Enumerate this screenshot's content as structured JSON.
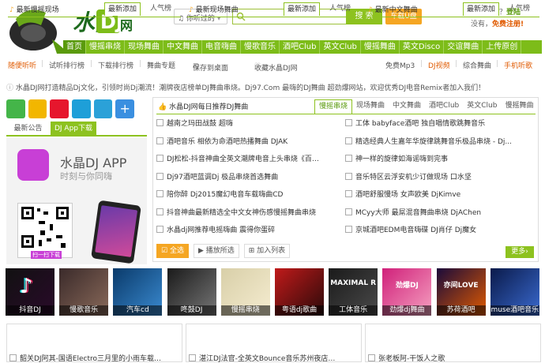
{
  "header": {
    "genre_select": "♫ 你听过的",
    "genre_arrow": "▾",
    "search_button": "搜 索",
    "udisk_button": "车载U盘",
    "login_prefix": "已有帐号？",
    "login_link": "登陆",
    "register_prefix": "没有，",
    "register_link": "免费注册!"
  },
  "main_nav": [
    "首页",
    "慢摇串烧",
    "现场舞曲",
    "中文舞曲",
    "电音嗨曲",
    "慢歌音乐",
    "酒吧Club",
    "英文Club",
    "慢摇舞曲",
    "英文Disco",
    "交谊舞曲",
    "上传原创"
  ],
  "sub_nav": {
    "left": [
      "随便听听",
      "试听排行榜",
      "下载排行榜",
      "舞曲专题"
    ],
    "save_desktop": "保存到桌面",
    "favorite": "收藏水晶DJ网",
    "right": [
      "免费Mp3",
      "DJ视频",
      "综合舞曲",
      "手机听歌"
    ]
  },
  "marquee": "水晶DJ网打造精品Dj文化，引领时尚Dj潮流！潮牌夜店榜单DJ舞曲串烧。Dj97.Com 最嗨的DJ舞曲 超劲爆网站，欢迎优秀DJ电音Remix者加入我们！",
  "left": {
    "tab_notice": "最新公告",
    "tab_app": "DJ App下载",
    "app_title": "水晶DJ APP",
    "app_slogan": "时刻与你同嗨",
    "qr_caption": "扫一扫下载"
  },
  "recommend": {
    "title": "水晶DJ网每日推荐DJ舞曲",
    "tabs": [
      "慢摇串烧",
      "现场舞曲",
      "中文舞曲",
      "酒吧Club",
      "英文Club",
      "慢摇舞曲"
    ],
    "left_items": [
      "越南之玛田战鼓 超嗨",
      "酒吧音乐 相依为命酒吧热播舞曲 DJAK",
      "DJ松松-抖音神曲全英文潮牌电音上头串烧《百…",
      "Dj97酒吧蓝调Dj 极品串烧首选舞曲",
      "陪你醉 Dj2015魔幻电音车载嗨曲CD",
      "抖音神曲最新精选全中文女神伤感慢摇舞曲串烧",
      "水晶dj网推荐电摇嗨曲 震得你蛋碎"
    ],
    "right_items": [
      "工体 babyface酒吧 独自唱情歌跳舞音乐",
      "精选经典人生嘉年华旋律跳舞音乐极品串烧 - Dj...",
      "神一样的旋律如海谣嗨到完事",
      "音乐特区云浮安机少订做现场 口水坚",
      "酒吧舒服慢场 女声欧美 DjKimve",
      "MCyy大师 最屌混音舞曲串烧 DjAChen",
      "京城酒吧EDM电音嗨碟 DJ肖仔 Dj魔女"
    ],
    "select_all": "全选",
    "play_selected": "播放所选",
    "add_list": "加入列表",
    "more": "更多"
  },
  "thumbnails": [
    "抖音DJ",
    "慢歌音乐",
    "汽车cd",
    "咚鼓DJ",
    "慢摇串烧",
    "粤语dj歌曲",
    "工体音乐",
    "劲爆dj舞曲",
    "苏荷酒吧",
    "muse酒吧音乐"
  ],
  "thumb_overlay": [
    "",
    "",
    "",
    "",
    "",
    "",
    "MAXIMAL RNB",
    "劲爆DJ",
    "亦间LOVE",
    ""
  ],
  "sections": [
    {
      "title": "最新慢摇现场",
      "tab1": "最新添加",
      "tab2": "人气榜",
      "first": "韶关DJ阿其-国语Electro三月里的小雨车载…"
    },
    {
      "title": "最新现场舞曲",
      "tab1": "最新添加",
      "tab2": "人气榜",
      "first": "湛江DJ法官-全英文Bounce音乐苏州夜店…"
    },
    {
      "title": "最新中文舞曲",
      "tab1": "最新添加",
      "tab2": "人气榜",
      "first": "张老板阿-干饭人之歌"
    }
  ],
  "colors": {
    "accent": "#8dc21f",
    "nav": "#7dbc19",
    "orange": "#f5a623",
    "highlight": "#e05a00"
  }
}
